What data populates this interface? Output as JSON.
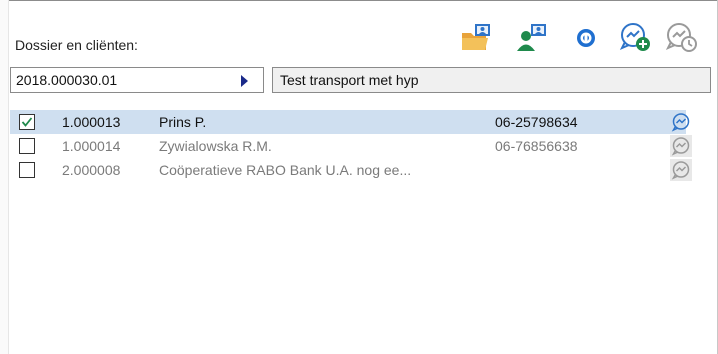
{
  "panel": {
    "title": "Dossier en cliënten:",
    "dossier_value": "2018.000030.01",
    "dossier_name": "Test transport met hyp"
  },
  "toolbar": {
    "icons": [
      "folder-user-icon",
      "person-user-icon",
      "circle-badge-icon",
      "add-conversation-icon",
      "conversation-history-icon"
    ]
  },
  "clients": [
    {
      "checked": true,
      "code": "1.000013",
      "name": "Prins P.",
      "phone": "06-25798634"
    },
    {
      "checked": false,
      "code": "1.000014",
      "name": "Zywialowska R.M.",
      "phone": "06-76856638"
    },
    {
      "checked": false,
      "code": "2.000008",
      "name": "Coöperatieve RABO Bank U.A. nog ee...",
      "phone": ""
    }
  ],
  "colors": {
    "selection": "#cfdff0",
    "accent_blue": "#1f6fd0",
    "person_green": "#1f8a4c",
    "folder_orange": "#e8a33a"
  }
}
